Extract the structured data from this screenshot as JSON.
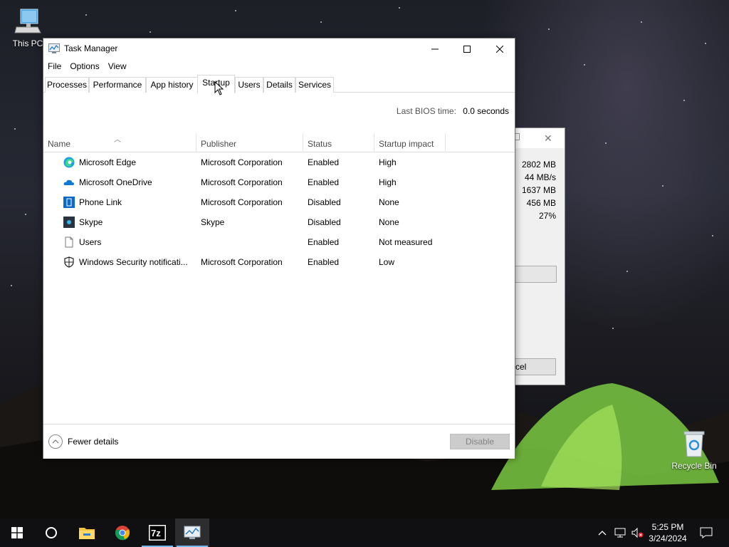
{
  "desktop": {
    "icons": [
      {
        "label": "This PC",
        "icon": "computer-icon"
      },
      {
        "label": "Recycle Bin",
        "icon": "recycle-bin-icon"
      }
    ]
  },
  "background_dialog": {
    "values": [
      "2802 MB",
      "44 MB/s",
      "1637 MB",
      "456 MB",
      "27%"
    ],
    "button_partial": "cel"
  },
  "task_manager": {
    "title": "Task Manager",
    "menu": [
      "File",
      "Options",
      "View"
    ],
    "tabs": [
      "Processes",
      "Performance",
      "App history",
      "Startup",
      "Users",
      "Details",
      "Services"
    ],
    "active_tab": "Startup",
    "bios_label": "Last BIOS time:",
    "bios_value": "0.0 seconds",
    "columns": [
      "Name",
      "Publisher",
      "Status",
      "Startup impact"
    ],
    "rows": [
      {
        "icon": "edge-icon",
        "name": "Microsoft Edge",
        "publisher": "Microsoft Corporation",
        "status": "Enabled",
        "impact": "High"
      },
      {
        "icon": "onedrive-icon",
        "name": "Microsoft OneDrive",
        "publisher": "Microsoft Corporation",
        "status": "Enabled",
        "impact": "High"
      },
      {
        "icon": "phone-link-icon",
        "name": "Phone Link",
        "publisher": "Microsoft Corporation",
        "status": "Disabled",
        "impact": "None"
      },
      {
        "icon": "skype-icon",
        "name": "Skype",
        "publisher": "Skype",
        "status": "Disabled",
        "impact": "None"
      },
      {
        "icon": "file-icon",
        "name": "Users",
        "publisher": "",
        "status": "Enabled",
        "impact": "Not measured"
      },
      {
        "icon": "shield-icon",
        "name": "Windows Security notificati...",
        "publisher": "Microsoft Corporation",
        "status": "Enabled",
        "impact": "Low"
      }
    ],
    "footer": {
      "fewer_details": "Fewer details",
      "disable_button": "Disable"
    }
  },
  "taskbar": {
    "items": [
      "start-icon",
      "cortana-icon",
      "file-explorer-icon",
      "chrome-icon",
      "7zip-icon",
      "task-manager-icon"
    ],
    "clock": {
      "time": "5:25 PM",
      "date": "3/24/2024"
    }
  }
}
